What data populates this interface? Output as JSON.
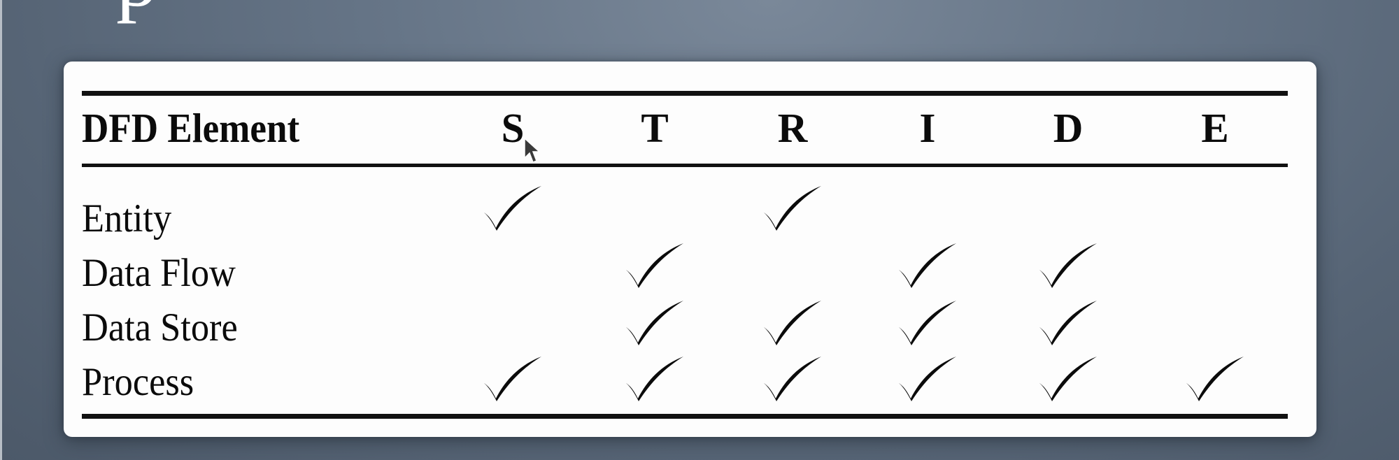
{
  "slide": {
    "title_fragment": "p"
  },
  "table": {
    "header": {
      "element_label": "DFD Element",
      "columns": [
        "S",
        "T",
        "R",
        "I",
        "D",
        "E"
      ]
    },
    "rows": [
      {
        "label": "Entity",
        "checks": [
          true,
          false,
          true,
          false,
          false,
          false
        ]
      },
      {
        "label": "Data Flow",
        "checks": [
          false,
          true,
          false,
          true,
          true,
          false
        ]
      },
      {
        "label": "Data Store",
        "checks": [
          false,
          true,
          true,
          true,
          true,
          false
        ]
      },
      {
        "label": "Process",
        "checks": [
          true,
          true,
          true,
          true,
          true,
          true
        ]
      }
    ],
    "check_icon": "checkmark-icon"
  },
  "colors": {
    "background": "#5e6b7c",
    "card": "#fdfdfd",
    "ink": "#0b0b0b"
  },
  "cursor": {
    "icon": "mouse-pointer-icon"
  }
}
